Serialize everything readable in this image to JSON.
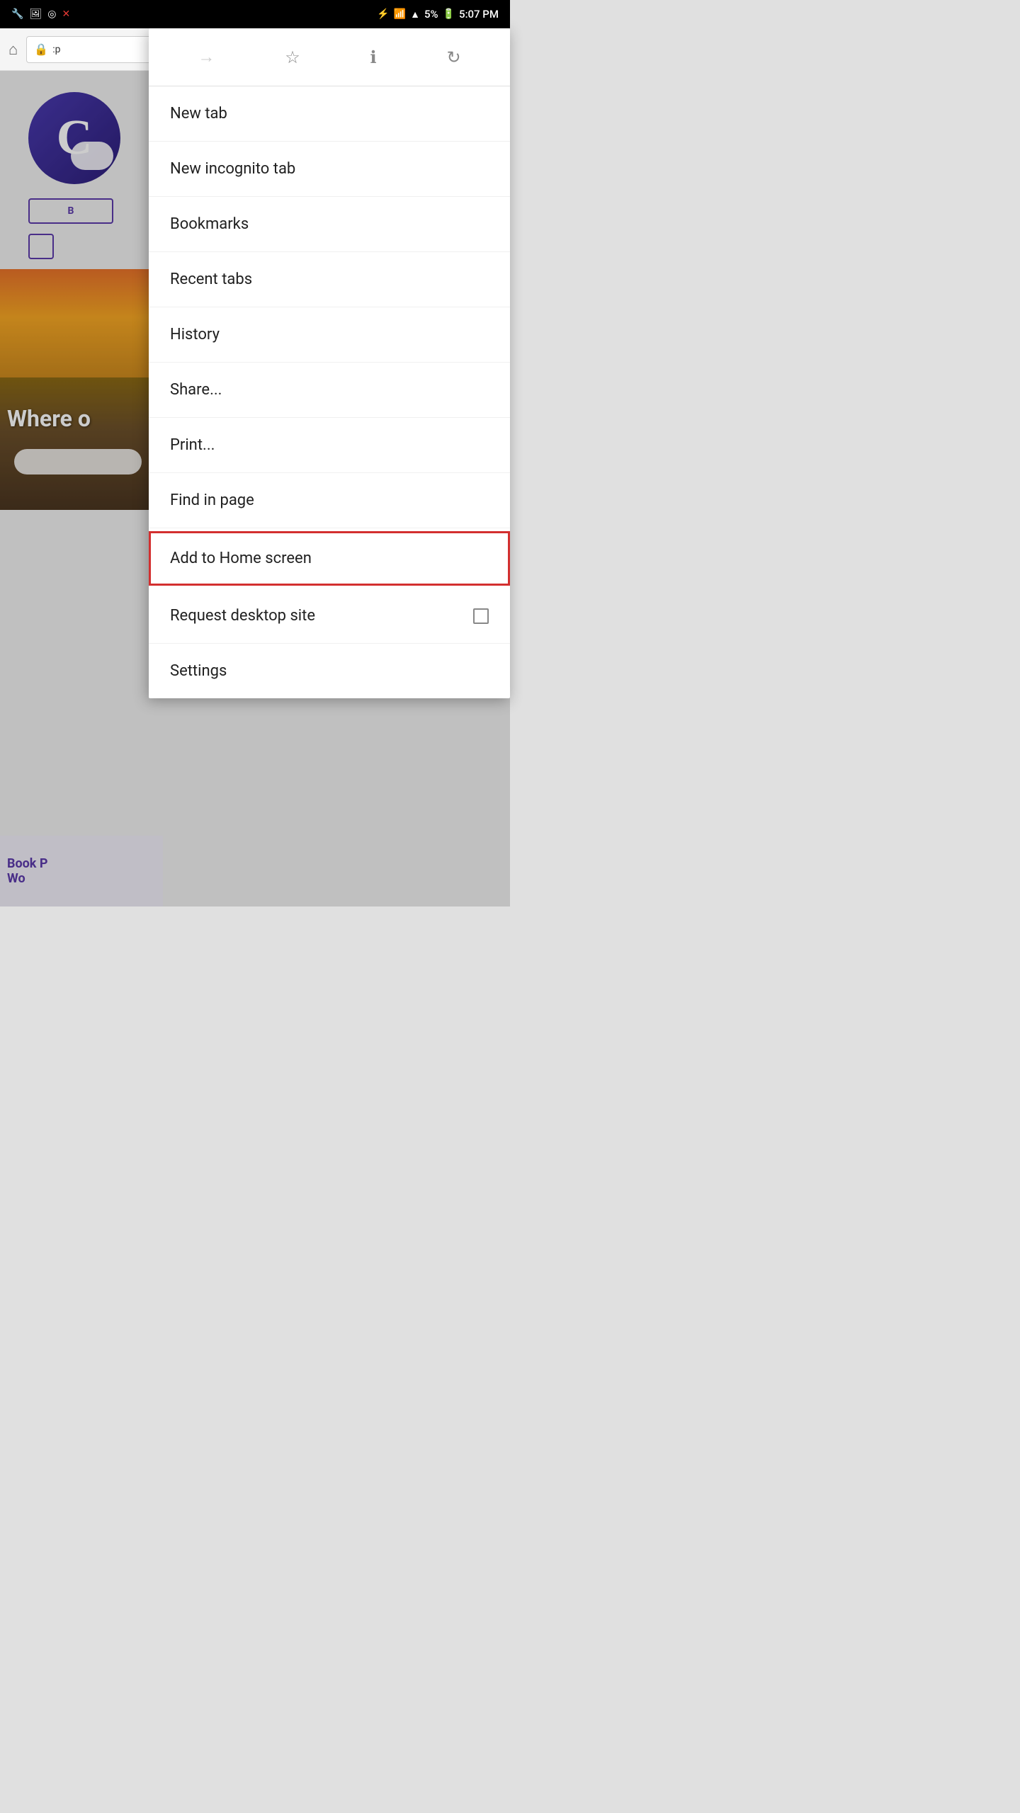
{
  "statusBar": {
    "time": "5:07 PM",
    "battery": "5%",
    "batteryCharging": true
  },
  "browser": {
    "addressBarText": ":p",
    "lockIcon": "🔒"
  },
  "backgroundPage": {
    "whereText": "Where o",
    "bookTitle": "Book P",
    "bookSubtitle": "Wo"
  },
  "menuToolbar": {
    "forwardIcon": "→",
    "bookmarkIcon": "☆",
    "infoIcon": "ℹ",
    "refreshIcon": "↻"
  },
  "menuItems": [
    {
      "id": "new-tab",
      "label": "New tab",
      "highlighted": false
    },
    {
      "id": "new-incognito-tab",
      "label": "New incognito tab",
      "highlighted": false
    },
    {
      "id": "bookmarks",
      "label": "Bookmarks",
      "highlighted": false
    },
    {
      "id": "recent-tabs",
      "label": "Recent tabs",
      "highlighted": false
    },
    {
      "id": "history",
      "label": "History",
      "highlighted": false
    },
    {
      "id": "share",
      "label": "Share...",
      "highlighted": false
    },
    {
      "id": "print",
      "label": "Print...",
      "highlighted": false
    },
    {
      "id": "find-in-page",
      "label": "Find in page",
      "highlighted": false
    },
    {
      "id": "add-to-home-screen",
      "label": "Add to Home screen",
      "highlighted": true
    },
    {
      "id": "request-desktop-site",
      "label": "Request desktop site",
      "hasCheckbox": true,
      "highlighted": false
    },
    {
      "id": "settings",
      "label": "Settings",
      "highlighted": false
    }
  ]
}
